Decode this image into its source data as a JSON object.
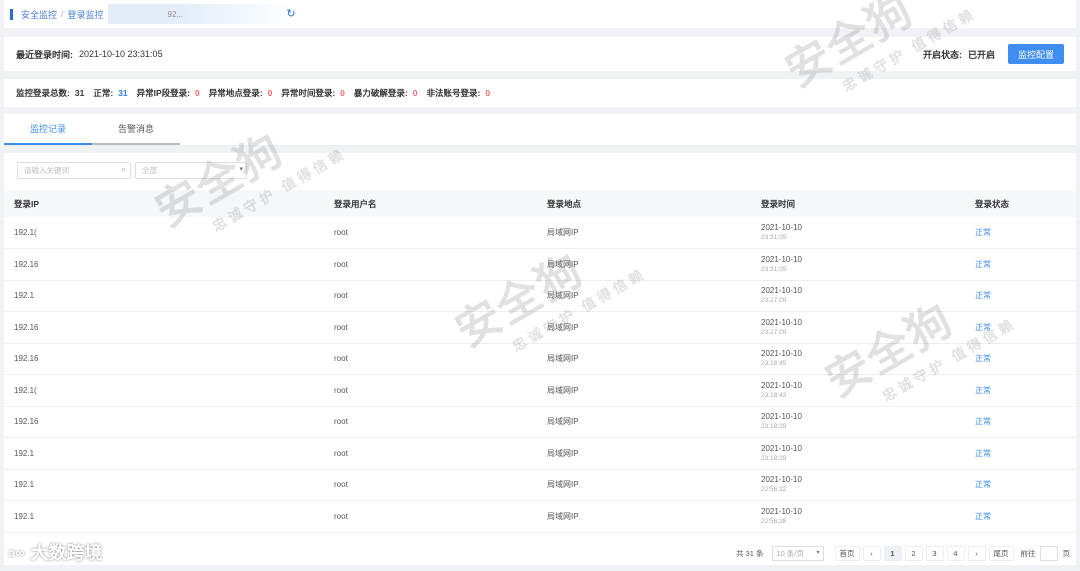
{
  "breadcrumb": {
    "items": [
      "安全监控",
      "登录监控"
    ],
    "tab_label": "92..."
  },
  "last_login": {
    "label": "最近登录时间:",
    "value": "2021-10-10 23:31:05",
    "status_label": "开启状态:",
    "status_value": "已开启",
    "config_button": "监控配置"
  },
  "stats": [
    {
      "label": "监控登录总数:",
      "value": "31",
      "color": "default"
    },
    {
      "label": "正常:",
      "value": "31",
      "color": "blue"
    },
    {
      "label": "异常IP段登录:",
      "value": "0",
      "color": "red"
    },
    {
      "label": "异常地点登录:",
      "value": "0",
      "color": "red"
    },
    {
      "label": "异常时间登录:",
      "value": "0",
      "color": "red"
    },
    {
      "label": "暴力破解登录:",
      "value": "0",
      "color": "red"
    },
    {
      "label": "非法账号登录:",
      "value": "0",
      "color": "red"
    }
  ],
  "tabs": [
    "监控记录",
    "告警消息"
  ],
  "filters": {
    "search_placeholder": "请输入关键词",
    "select_value": "全部"
  },
  "table": {
    "headers": [
      "登录IP",
      "登录用户名",
      "登录地点",
      "登录时间",
      "登录状态"
    ],
    "rows": [
      {
        "ip": "192.1(",
        "user": "root",
        "location": "局域网IP",
        "date": "2021-10-10",
        "time": "23:31:05",
        "status": "正常"
      },
      {
        "ip": "192.16",
        "user": "root",
        "location": "局域网IP",
        "date": "2021-10-10",
        "time": "23:31:05",
        "status": "正常"
      },
      {
        "ip": "192.1",
        "user": "root",
        "location": "局域网IP",
        "date": "2021-10-10",
        "time": "23:27:09",
        "status": "正常"
      },
      {
        "ip": "192.16",
        "user": "root",
        "location": "局域网IP",
        "date": "2021-10-10",
        "time": "23:27:09",
        "status": "正常"
      },
      {
        "ip": "192.16",
        "user": "root",
        "location": "局域网IP",
        "date": "2021-10-10",
        "time": "23:18:45",
        "status": "正常"
      },
      {
        "ip": "192.1(",
        "user": "root",
        "location": "局域网IP",
        "date": "2021-10-10",
        "time": "23:18:43",
        "status": "正常"
      },
      {
        "ip": "192.16",
        "user": "root",
        "location": "局域网IP",
        "date": "2021-10-10",
        "time": "23:18:29",
        "status": "正常"
      },
      {
        "ip": "192.1",
        "user": "root",
        "location": "局域网IP",
        "date": "2021-10-10",
        "time": "23:18:29",
        "status": "正常"
      },
      {
        "ip": "192.1",
        "user": "root",
        "location": "局域网IP",
        "date": "2021-10-10",
        "time": "22:56:32",
        "status": "正常"
      },
      {
        "ip": "192.1",
        "user": "root",
        "location": "局域网IP",
        "date": "2021-10-10",
        "time": "22:56:28",
        "status": "正常"
      }
    ]
  },
  "pagination": {
    "total": "共 31 条",
    "page_size": "10 条/页",
    "first": "首页",
    "prev": "‹",
    "pages": [
      "1",
      "2",
      "3",
      "4"
    ],
    "current": "1",
    "next": "›",
    "last": "尾页",
    "goto_label": "前往",
    "goto_unit": "页"
  },
  "watermark": {
    "brand_text": "安全狗",
    "slogan": "忠诚守护 值得信赖",
    "corner_text": "大数跨境"
  },
  "colors": {
    "primary": "#3d8ef0",
    "danger": "#f56c6c",
    "accent_bar": "#2b6cd4"
  }
}
